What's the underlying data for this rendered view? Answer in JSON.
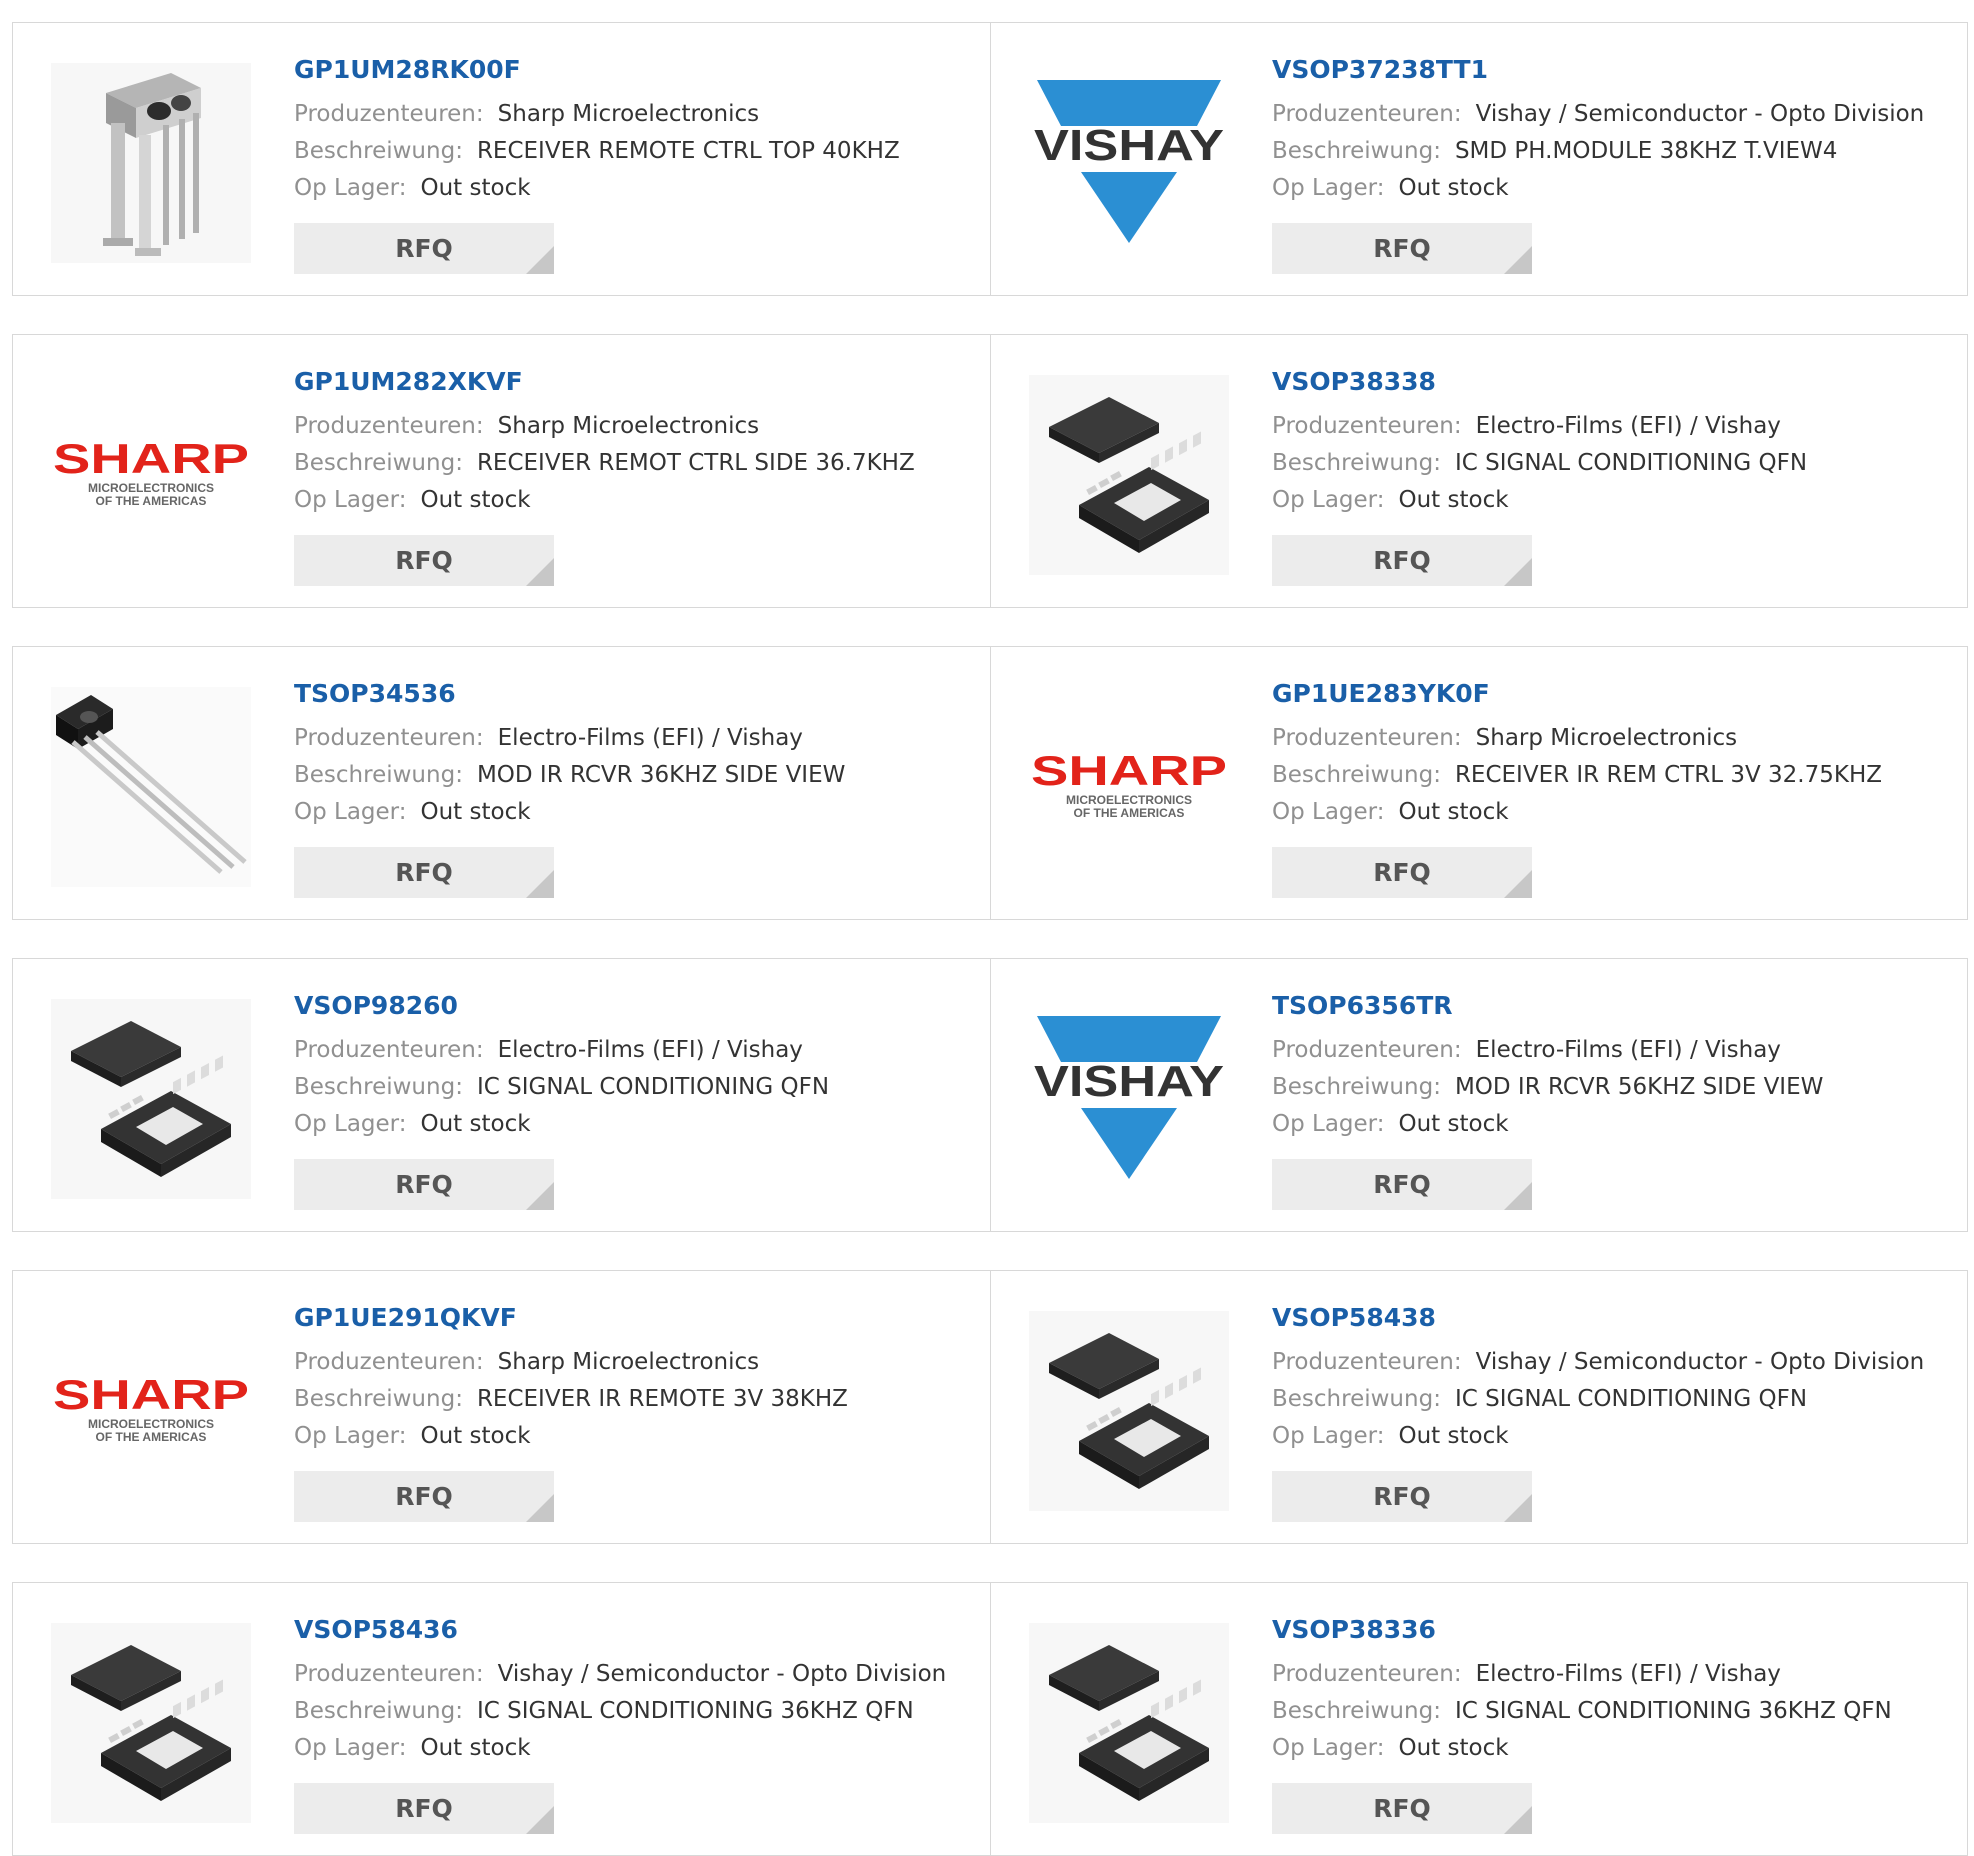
{
  "labels": {
    "manufacturer": "Produzenteuren:",
    "description": "Beschreiwung:",
    "stock": "Op Lager:",
    "rfq": "RFQ"
  },
  "brand_logos": {
    "vishay": "VISHAY",
    "sharp": "SHARP",
    "sharp_sub1": "MICROELECTRONICS",
    "sharp_sub2": "OF THE AMERICAS"
  },
  "colors": {
    "part_number": "#1a5fa8",
    "vishay_blue": "#2b8fd3",
    "sharp_red": "#e2231a"
  },
  "products": [
    {
      "part": "GP1UM28RK00F",
      "manufacturer": "Sharp Microelectronics",
      "description": "RECEIVER REMOTE CTRL TOP 40KHZ",
      "stock": "Out stock",
      "image": "ir-receiver-module"
    },
    {
      "part": "VSOP37238TT1",
      "manufacturer": "Vishay / Semiconductor - Opto Division",
      "description": "SMD PH.MODULE 38KHZ T.VIEW4",
      "stock": "Out stock",
      "image": "vishay-logo"
    },
    {
      "part": "GP1UM282XKVF",
      "manufacturer": "Sharp Microelectronics",
      "description": "RECEIVER REMOT CTRL SIDE 36.7KHZ",
      "stock": "Out stock",
      "image": "sharp-logo"
    },
    {
      "part": "VSOP38338",
      "manufacturer": "Electro-Films (EFI) / Vishay",
      "description": "IC SIGNAL CONDITIONING QFN",
      "stock": "Out stock",
      "image": "qfn-chip"
    },
    {
      "part": "TSOP34536",
      "manufacturer": "Electro-Films (EFI) / Vishay",
      "description": "MOD IR RCVR 36KHZ SIDE VIEW",
      "stock": "Out stock",
      "image": "ir-sensor-leads"
    },
    {
      "part": "GP1UE283YK0F",
      "manufacturer": "Sharp Microelectronics",
      "description": "RECEIVER IR REM CTRL 3V 32.75KHZ",
      "stock": "Out stock",
      "image": "sharp-logo"
    },
    {
      "part": "VSOP98260",
      "manufacturer": "Electro-Films (EFI) / Vishay",
      "description": "IC SIGNAL CONDITIONING QFN",
      "stock": "Out stock",
      "image": "qfn-chip"
    },
    {
      "part": "TSOP6356TR",
      "manufacturer": "Electro-Films (EFI) / Vishay",
      "description": "MOD IR RCVR 56KHZ SIDE VIEW",
      "stock": "Out stock",
      "image": "vishay-logo"
    },
    {
      "part": "GP1UE291QKVF",
      "manufacturer": "Sharp Microelectronics",
      "description": "RECEIVER IR REMOTE 3V 38KHZ",
      "stock": "Out stock",
      "image": "sharp-logo"
    },
    {
      "part": "VSOP58438",
      "manufacturer": "Vishay / Semiconductor - Opto Division",
      "description": "IC SIGNAL CONDITIONING QFN",
      "stock": "Out stock",
      "image": "qfn-chip"
    },
    {
      "part": "VSOP58436",
      "manufacturer": "Vishay / Semiconductor - Opto Division",
      "description": "IC SIGNAL CONDITIONING 36KHZ QFN",
      "stock": "Out stock",
      "image": "qfn-chip"
    },
    {
      "part": "VSOP38336",
      "manufacturer": "Electro-Films (EFI) / Vishay",
      "description": "IC SIGNAL CONDITIONING 36KHZ QFN",
      "stock": "Out stock",
      "image": "qfn-chip"
    }
  ]
}
